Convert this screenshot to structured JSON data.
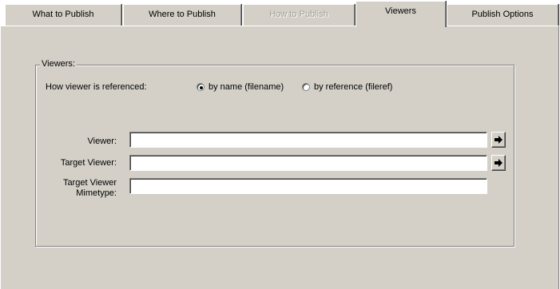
{
  "tabs": [
    {
      "label": "What to Publish",
      "state": "normal"
    },
    {
      "label": "Where to Publish",
      "state": "normal"
    },
    {
      "label": "How to Publish",
      "state": "disabled"
    },
    {
      "label": "Viewers",
      "state": "active"
    },
    {
      "label": "Publish Options",
      "state": "normal"
    }
  ],
  "viewers_group": {
    "title": "Viewers:",
    "reference_label": "How viewer is referenced:",
    "radio_by_name": {
      "label": "by name (filename)",
      "checked": true
    },
    "radio_by_reference": {
      "label": "by reference (fileref)",
      "checked": false
    },
    "viewer_label": "Viewer:",
    "viewer_value": "",
    "target_viewer_label": "Target Viewer:",
    "target_viewer_value": "",
    "mimetype_label_line1": "Target Viewer",
    "mimetype_label_line2": "Mimetype:",
    "mimetype_value": "",
    "browse_icon": "right-arrow-icon"
  },
  "colors": {
    "face": "#d4d0c8",
    "highlight": "#ffffff",
    "shadow": "#808080",
    "dark_shadow": "#404040"
  }
}
